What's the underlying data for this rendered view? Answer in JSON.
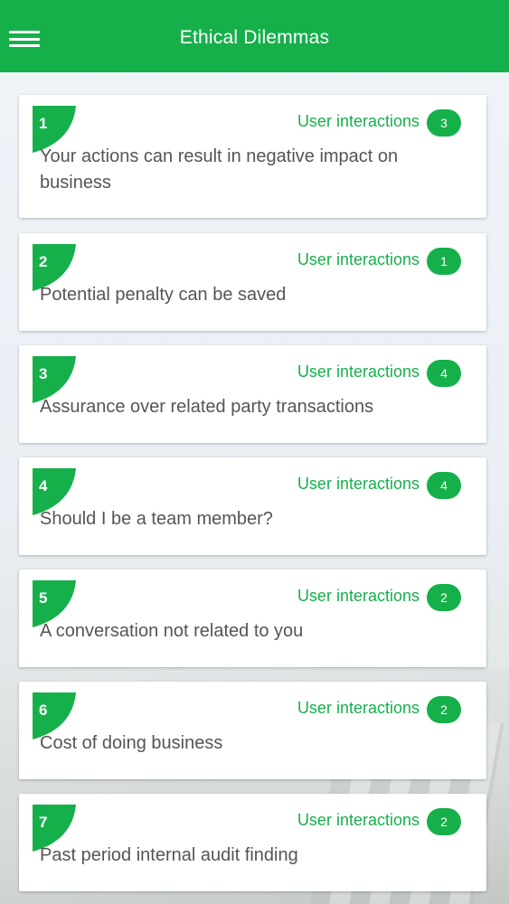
{
  "header": {
    "title": "Ethical Dilemmas",
    "menu_icon": "hamburger-menu-icon"
  },
  "accent_color": "#16b04b",
  "dilemmas": [
    {
      "number": "1",
      "interactions_label": "User interactions",
      "count": "3",
      "title": "Your actions can result in negative impact on business"
    },
    {
      "number": "2",
      "interactions_label": "User interactions",
      "count": "1",
      "title": "Potential penalty can be saved"
    },
    {
      "number": "3",
      "interactions_label": "User interactions",
      "count": "4",
      "title": "Assurance over related party transactions"
    },
    {
      "number": "4",
      "interactions_label": "User interactions",
      "count": "4",
      "title": "Should I be a team member?"
    },
    {
      "number": "5",
      "interactions_label": "User interactions",
      "count": "2",
      "title": "A conversation not related to you"
    },
    {
      "number": "6",
      "interactions_label": "User interactions",
      "count": "2",
      "title": "Cost of doing business"
    },
    {
      "number": "7",
      "interactions_label": "User interactions",
      "count": "2",
      "title": "Past period internal audit finding"
    }
  ]
}
